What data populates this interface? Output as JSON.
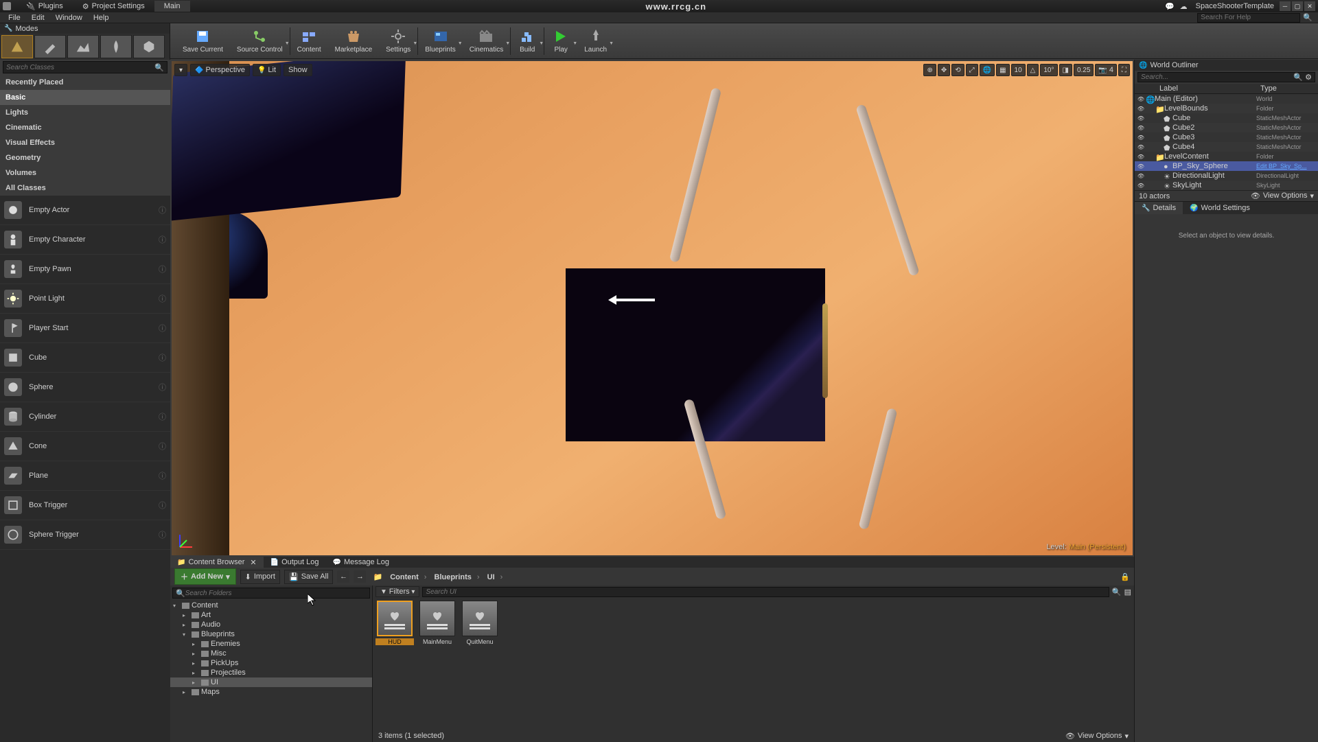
{
  "title_tabs": [
    "Plugins",
    "Project Settings",
    "Main"
  ],
  "watermark_url": "www.rrcg.cn",
  "project_name": "SpaceShooterTemplate",
  "menu": [
    "File",
    "Edit",
    "Window",
    "Help"
  ],
  "menu_search_placeholder": "Search For Help",
  "modes_label": "Modes",
  "toolbar": [
    {
      "label": "Save Current"
    },
    {
      "label": "Source Control"
    },
    {
      "label": "Content"
    },
    {
      "label": "Marketplace"
    },
    {
      "label": "Settings"
    },
    {
      "label": "Blueprints"
    },
    {
      "label": "Cinematics"
    },
    {
      "label": "Build"
    },
    {
      "label": "Play"
    },
    {
      "label": "Launch"
    }
  ],
  "search_classes_placeholder": "Search Classes",
  "categories": [
    "Recently Placed",
    "Basic",
    "Lights",
    "Cinematic",
    "Visual Effects",
    "Geometry",
    "Volumes",
    "All Classes"
  ],
  "active_category": "Basic",
  "actors": [
    "Empty Actor",
    "Empty Character",
    "Empty Pawn",
    "Point Light",
    "Player Start",
    "Cube",
    "Sphere",
    "Cylinder",
    "Cone",
    "Plane",
    "Box Trigger",
    "Sphere Trigger"
  ],
  "viewport": {
    "dropdown": "Perspective",
    "lit": "Lit",
    "show": "Show",
    "snap1": "10",
    "snap2": "10°",
    "snap3": "0.25",
    "cam": "4",
    "level_label": "Level:",
    "level_name": "Main (Persistent)"
  },
  "bottom_tabs": [
    "Content Browser",
    "Output Log",
    "Message Log"
  ],
  "content_browser": {
    "add_new": "Add New",
    "import": "Import",
    "save_all": "Save All",
    "breadcrumb": [
      "Content",
      "Blueprints",
      "UI"
    ],
    "filters_label": "Filters",
    "search_folders_placeholder": "Search Folders",
    "search_assets_placeholder": "Search UI",
    "tree": [
      {
        "label": "Content",
        "depth": 0,
        "open": true
      },
      {
        "label": "Art",
        "depth": 1,
        "open": false
      },
      {
        "label": "Audio",
        "depth": 1,
        "open": false
      },
      {
        "label": "Blueprints",
        "depth": 1,
        "open": true
      },
      {
        "label": "Enemies",
        "depth": 2,
        "open": false
      },
      {
        "label": "Misc",
        "depth": 2,
        "open": false
      },
      {
        "label": "PickUps",
        "depth": 2,
        "open": false
      },
      {
        "label": "Projectiles",
        "depth": 2,
        "open": false
      },
      {
        "label": "UI",
        "depth": 2,
        "open": false,
        "selected": true
      },
      {
        "label": "Maps",
        "depth": 1,
        "open": false
      }
    ],
    "assets": [
      {
        "name": "HUD",
        "selected": true
      },
      {
        "name": "MainMenu"
      },
      {
        "name": "QuitMenu"
      }
    ],
    "status": "3 items (1 selected)",
    "view_options": "View Options"
  },
  "outliner": {
    "title": "World Outliner",
    "search_placeholder": "Search...",
    "columns": [
      "Label",
      "Type"
    ],
    "rows": [
      {
        "label": "Main (Editor)",
        "type": "World",
        "depth": 0,
        "icon": "world"
      },
      {
        "label": "LevelBounds",
        "type": "Folder",
        "depth": 1,
        "icon": "folder"
      },
      {
        "label": "Cube",
        "type": "StaticMeshActor",
        "depth": 2,
        "icon": "mesh"
      },
      {
        "label": "Cube2",
        "type": "StaticMeshActor",
        "depth": 2,
        "icon": "mesh"
      },
      {
        "label": "Cube3",
        "type": "StaticMeshActor",
        "depth": 2,
        "icon": "mesh"
      },
      {
        "label": "Cube4",
        "type": "StaticMeshActor",
        "depth": 2,
        "icon": "mesh"
      },
      {
        "label": "LevelContent",
        "type": "Folder",
        "depth": 1,
        "icon": "folder"
      },
      {
        "label": "BP_Sky_Sphere",
        "type": "Edit BP_Sky_Sp...",
        "depth": 2,
        "icon": "sphere",
        "link": true,
        "selected": true
      },
      {
        "label": "DirectionalLight",
        "type": "DirectionalLight",
        "depth": 2,
        "icon": "light"
      },
      {
        "label": "SkyLight",
        "type": "SkyLight",
        "depth": 2,
        "icon": "light"
      }
    ],
    "footer_count": "10 actors",
    "view_options": "View Options"
  },
  "details": {
    "tabs": [
      "Details",
      "World Settings"
    ],
    "empty_message": "Select an object to view details."
  }
}
